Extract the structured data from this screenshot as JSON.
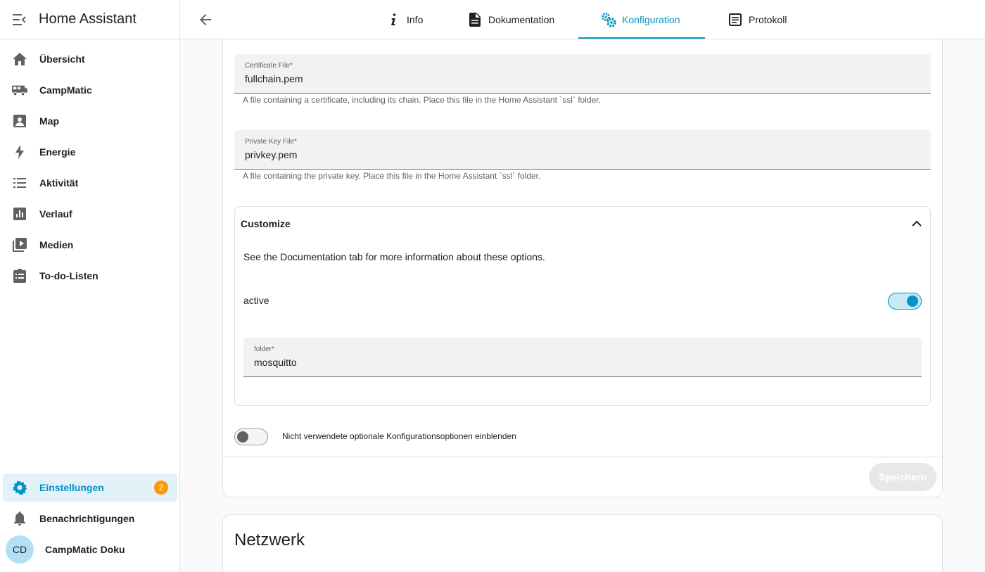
{
  "sidebar": {
    "title": "Home Assistant",
    "items": [
      {
        "label": "Übersicht",
        "icon": "home-icon"
      },
      {
        "label": "CampMatic",
        "icon": "rv-icon"
      },
      {
        "label": "Map",
        "icon": "account-box-icon"
      },
      {
        "label": "Energie",
        "icon": "lightning-bolt-icon"
      },
      {
        "label": "Aktivität",
        "icon": "format-list-icon"
      },
      {
        "label": "Verlauf",
        "icon": "chart-box-icon"
      },
      {
        "label": "Medien",
        "icon": "play-box-multiple-icon"
      },
      {
        "label": "To-do-Listen",
        "icon": "clipboard-list-icon"
      }
    ],
    "settings": {
      "label": "Einstellungen",
      "badge": "2",
      "icon": "cog-icon"
    },
    "notifications": {
      "label": "Benachrichtigungen",
      "icon": "bell-icon"
    },
    "user": {
      "initials": "CD",
      "name": "CampMatic Doku"
    }
  },
  "tabs": [
    {
      "label": "Info",
      "icon": "info-icon"
    },
    {
      "label": "Dokumentation",
      "icon": "file-document-icon"
    },
    {
      "label": "Konfiguration",
      "icon": "cogs-icon",
      "active": true
    },
    {
      "label": "Protokoll",
      "icon": "text-box-icon"
    }
  ],
  "config": {
    "certfile": {
      "label": "Certificate File*",
      "value": "fullchain.pem",
      "hint": "A file containing a certificate, including its chain. Place this file in the Home Assistant `ssl` folder."
    },
    "keyfile": {
      "label": "Private Key File*",
      "value": "privkey.pem",
      "hint": "A file containing the private key. Place this file in the Home Assistant `ssl` folder."
    },
    "customize": {
      "title": "Customize",
      "description": "See the Documentation tab for more information about these options.",
      "active_label": "active",
      "active_value": true,
      "folder": {
        "label": "folder*",
        "value": "mosquitto"
      }
    },
    "show_unused_label": "Nicht verwendete optionale Konfigurationsoptionen einblenden",
    "show_unused_value": false,
    "save_label": "Speichern"
  },
  "network": {
    "title": "Netzwerk"
  },
  "colors": {
    "accent": "#0393c7",
    "badge": "#ff9800"
  }
}
